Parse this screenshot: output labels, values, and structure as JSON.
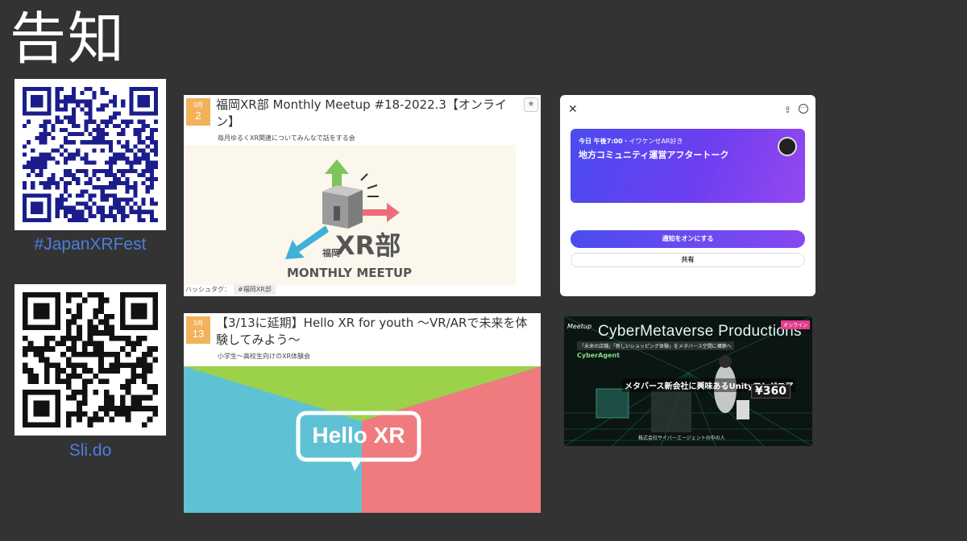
{
  "page": {
    "title": "告知"
  },
  "qr_codes": [
    {
      "caption": "#JapanXRFest",
      "color": "#1c1d8c"
    },
    {
      "caption": "Sli.do",
      "color": "#111111"
    }
  ],
  "events": [
    {
      "date_month": "3月",
      "date_day": "2",
      "title": "福岡XR部 Monthly Meetup #18-2022.3【オンライン】",
      "subtitle": "毎月ゆるくXR関連についてみんなで話をする会",
      "hashtag_label": "ハッシュタグ：",
      "hashtag": "#福岡XR部",
      "banner": {
        "kanji": "福岡",
        "brand": "XR部",
        "tagline": "MONTHLY MEETUP"
      }
    },
    {
      "date_month": "3月",
      "date_day": "13",
      "title": "【3/13に延期】Hello XR for youth ～VR/ARで未来を体験してみよう～",
      "subtitle": "小学生～高校生向けのXR体験会",
      "banner": {
        "logo_text": "Hello XR"
      }
    }
  ],
  "share_dialog": {
    "time_prefix": "今日 午後7:00",
    "host": "・イワケンせAR好き",
    "event_name": "地方コミュニティ運営アフタートーク",
    "primary_button": "通知をオンにする",
    "secondary_button": "共有",
    "accent": "#5a46f0"
  },
  "cyber_event": {
    "title": "CyberMetaverse Productions",
    "badge": "オンライン",
    "mark": "Meetup",
    "tagline": "「未来の店舗」「新しいショッピング体験」をメタバース空間に構築へ",
    "company_logo": "CyberAgent",
    "headline": "メタバース新会社に興味あるUnityエンジニア",
    "price": "¥360",
    "footer": "株式会社サイバーエージェントの中の人"
  }
}
